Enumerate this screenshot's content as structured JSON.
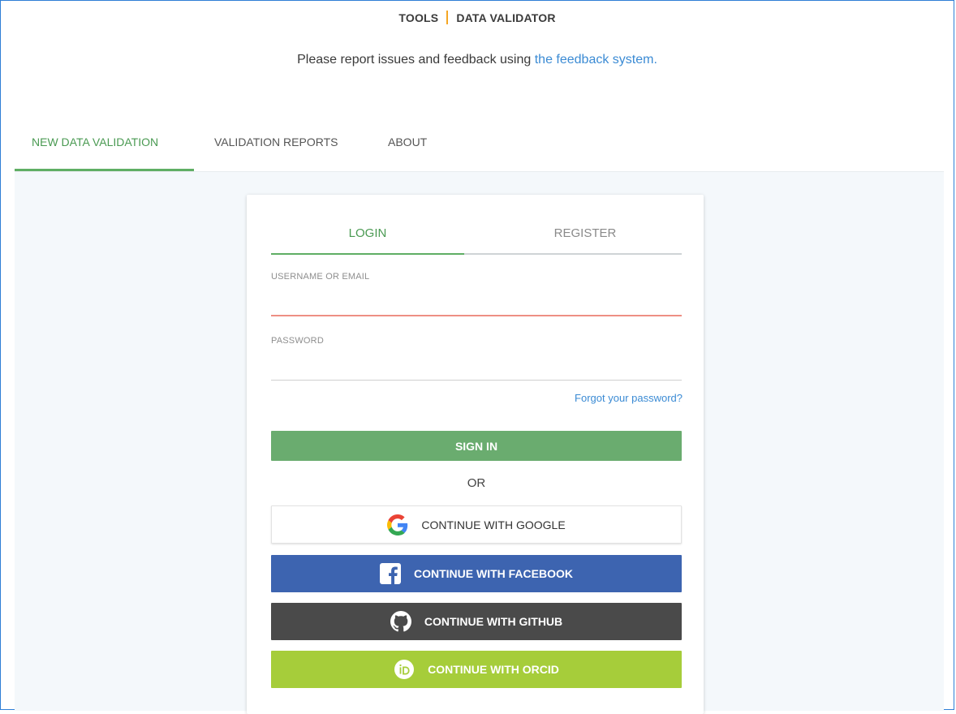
{
  "header": {
    "section": "TOOLS",
    "tool": "DATA VALIDATOR"
  },
  "notice": {
    "text": "Please report issues and feedback using ",
    "link": "the feedback system."
  },
  "nav": {
    "tabs": [
      {
        "label": "NEW DATA VALIDATION",
        "active": true
      },
      {
        "label": "VALIDATION REPORTS",
        "active": false
      },
      {
        "label": "ABOUT",
        "active": false
      }
    ]
  },
  "auth": {
    "tabs": [
      {
        "label": "LOGIN",
        "active": true
      },
      {
        "label": "REGISTER",
        "active": false
      }
    ],
    "username": {
      "label": "USERNAME OR EMAIL",
      "value": ""
    },
    "password": {
      "label": "PASSWORD",
      "value": ""
    },
    "forgot_link": "Forgot your password?",
    "signin_label": "SIGN IN",
    "or_label": "OR",
    "providers": {
      "google": {
        "label": "CONTINUE WITH GOOGLE",
        "icon": "google-icon"
      },
      "facebook": {
        "label": "CONTINUE WITH FACEBOOK",
        "icon": "facebook-icon"
      },
      "github": {
        "label": "CONTINUE WITH GITHUB",
        "icon": "github-icon"
      },
      "orcid": {
        "label": "CONTINUE WITH ORCID",
        "icon": "orcid-icon"
      }
    }
  },
  "colors": {
    "accent_green": "#5fae64",
    "link_blue": "#3b8bd4",
    "title_separator": "#f5a623",
    "facebook": "#3d64b0",
    "github": "#4a4a4a",
    "orcid": "#a6cd3a",
    "error_underline": "#ee8f84"
  }
}
